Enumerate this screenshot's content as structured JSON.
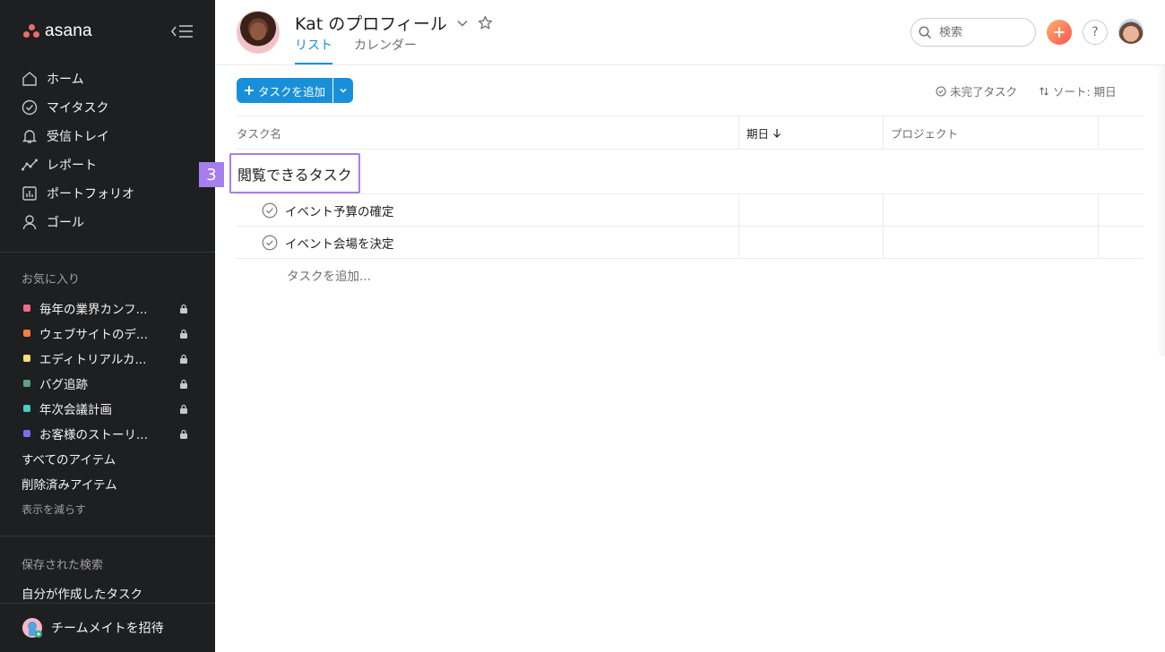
{
  "sidebar": {
    "logo_text": "asana",
    "nav": [
      {
        "label": "ホーム",
        "icon": "home-icon"
      },
      {
        "label": "マイタスク",
        "icon": "check-circle-icon"
      },
      {
        "label": "受信トレイ",
        "icon": "bell-icon"
      },
      {
        "label": "レポート",
        "icon": "chart-line-icon"
      },
      {
        "label": "ポートフォリオ",
        "icon": "portfolio-icon"
      },
      {
        "label": "ゴール",
        "icon": "person-icon"
      }
    ],
    "favorites_title": "お気に入り",
    "favorites": [
      {
        "label": "毎年の業界カンフ...",
        "color": "#f06a8a"
      },
      {
        "label": "ウェブサイトのデ...",
        "color": "#fd7e42"
      },
      {
        "label": "エディトリアルカ...",
        "color": "#f8df72"
      },
      {
        "label": "バグ追跡",
        "color": "#5da283"
      },
      {
        "label": "年次会議計画",
        "color": "#4ecbc4"
      },
      {
        "label": "お客様のストーリ...",
        "color": "#7a6ff0"
      }
    ],
    "all_items": "すべてのアイテム",
    "deleted_items": "削除済みアイテム",
    "show_less": "表示を減らす",
    "saved_searches_title": "保存された検索",
    "saved_search_item": "自分が作成したタスク",
    "invite_label": "チームメイトを招待"
  },
  "header": {
    "title": "Kat  のプロフィール",
    "tabs": [
      {
        "label": "リスト",
        "active": true
      },
      {
        "label": "カレンダー",
        "active": false
      }
    ],
    "search_placeholder": "検索",
    "help_label": "?"
  },
  "toolbar": {
    "add_task_label": "タスクを追加",
    "filter_label": "未完了タスク",
    "sort_label": "ソート: 期日"
  },
  "table": {
    "columns": {
      "name": "タスク名",
      "due": "期日",
      "project": "プロジェクト"
    },
    "section_title": "閲覧できるタスク",
    "badge": "3",
    "tasks": [
      {
        "name": "イベント予算の確定"
      },
      {
        "name": "イベント会場を決定"
      }
    ],
    "add_task_placeholder": "タスクを追加..."
  },
  "colors": {
    "accent": "#1a8fd9",
    "sidebar_bg": "#1e1f21",
    "highlight": "#a67ef0"
  }
}
